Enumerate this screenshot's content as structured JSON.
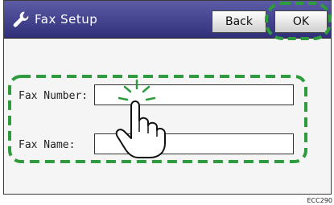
{
  "header": {
    "title": "Fax Setup",
    "back_label": "Back",
    "ok_label": "OK"
  },
  "form": {
    "fax_number_label": "Fax Number:",
    "fax_name_label": "Fax Name:",
    "fax_number_value": "",
    "fax_name_value": ""
  },
  "footer": {
    "code": "ECC290"
  },
  "colors": {
    "title_bar": "#3f3f8f",
    "highlight": "#2e9b3d"
  }
}
